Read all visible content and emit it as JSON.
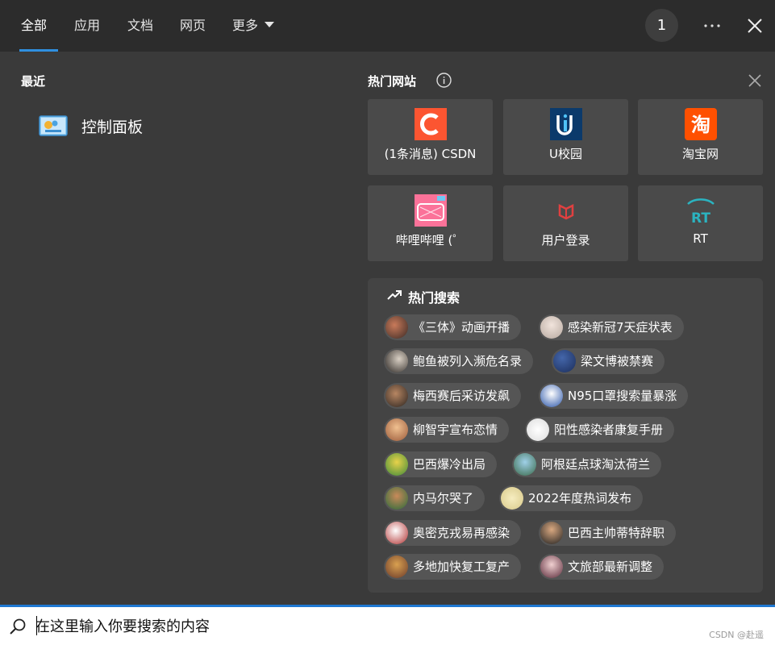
{
  "tabs": [
    {
      "label": "全部",
      "active": true
    },
    {
      "label": "应用"
    },
    {
      "label": "文档"
    },
    {
      "label": "网页"
    },
    {
      "label": "更多"
    }
  ],
  "header": {
    "badge_count": "1",
    "more_icon": "ellipsis-icon",
    "close_icon": "close-icon"
  },
  "recent": {
    "title": "最近",
    "items": [
      {
        "label": "控制面板",
        "icon": "control-panel-icon"
      }
    ]
  },
  "hot_sites": {
    "title": "热门网站",
    "tiles": [
      {
        "label": "(1条消息) CSDN",
        "icon": "csdn-icon",
        "color": "#fc5531"
      },
      {
        "label": "U校园",
        "icon": "u-campus-icon",
        "color": "#0b3a6b"
      },
      {
        "label": "淘宝网",
        "icon": "taobao-icon",
        "color": "#ff5000"
      },
      {
        "label": "哔哩哔哩 (゜",
        "icon": "bilibili-icon",
        "color": "#fb7299"
      },
      {
        "label": "用户登录",
        "icon": "login-icon",
        "color": "#e04040"
      },
      {
        "label": "RT",
        "icon": "rt-icon",
        "color": "#2bb3c0"
      }
    ]
  },
  "hot_search": {
    "title": "热门搜索",
    "items": [
      "《三体》动画开播",
      "感染新冠7天症状表",
      "鲍鱼被列入濒危名录",
      "梁文博被禁赛",
      "梅西赛后采访发飙",
      "N95口罩搜索量暴涨",
      "柳智宇宣布恋情",
      "阳性感染者康复手册",
      "巴西爆冷出局",
      "阿根廷点球淘汰荷兰",
      "内马尔哭了",
      "2022年度热词发布",
      "奥密克戎易再感染",
      "巴西主帅蒂特辞职",
      "多地加快复工复产",
      "文旅部最新调整"
    ]
  },
  "search": {
    "placeholder": "在这里输入你要搜索的内容"
  },
  "watermark": "CSDN @赴遥",
  "colors": {
    "accent": "#2f8fe0",
    "background": "#3a3a3a",
    "tile": "#4a4a4a"
  }
}
